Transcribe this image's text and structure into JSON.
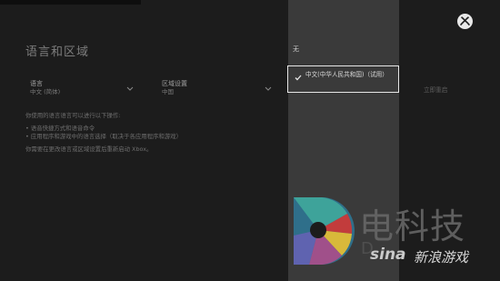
{
  "page": {
    "title": "语言和区域"
  },
  "settings": [
    {
      "label": "语言",
      "value": "中文 (简体)"
    },
    {
      "label": "区域设置",
      "value": "中国"
    }
  ],
  "description": {
    "intro": "你使用的语言语言可以进行以下操作:",
    "bullet1": "• 语音快捷方式和语音命令",
    "bullet2": "• 应用程序和游戏中的语言选择（取决于各应用程序和游戏）",
    "note": "你需要在更改语言或区域设置后重新启动 Xbox。"
  },
  "dropdown": {
    "header": "无",
    "selected": "中文(中华人民共和国)（试用）",
    "check_icon": "check-icon"
  },
  "restart_label": "立即重启",
  "watermark": {
    "cn": "电科技",
    "latin": "D",
    "sina": "sina",
    "sina_cn": "新浪游戏"
  }
}
